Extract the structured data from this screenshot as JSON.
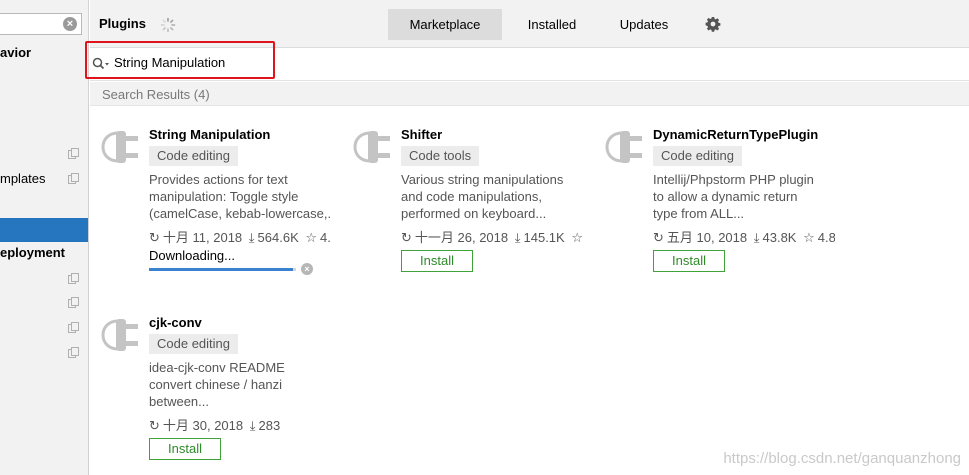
{
  "left_pane": {
    "search_value": "",
    "items": [
      "avior",
      "mplates",
      "eployment"
    ]
  },
  "header": {
    "title": "Plugins",
    "tabs": [
      "Marketplace",
      "Installed",
      "Updates"
    ],
    "active_tab": "Marketplace"
  },
  "search": {
    "value": "String Manipulation"
  },
  "results": {
    "label": "Search Results (4)"
  },
  "plugins": [
    {
      "name": "String Manipulation",
      "category": "Code editing",
      "description": [
        "Provides actions for text",
        "manipulation: Toggle style",
        "(camelCase, kebab-lowercase,."
      ],
      "date": "十月 11, 2018",
      "downloads": "564.6K",
      "rating": "4.",
      "status": "Downloading...",
      "progress": 0.98
    },
    {
      "name": "Shifter",
      "category": "Code tools",
      "description": [
        "Various string manipulations",
        "and code manipulations,",
        "performed on keyboard..."
      ],
      "date": "十一月 26, 2018",
      "downloads": "145.1K",
      "rating": "",
      "action": "Install"
    },
    {
      "name": "DynamicReturnTypePlugin",
      "category": "Code editing",
      "description": [
        "Intellij/Phpstorm PHP plugin",
        "to allow a dynamic return",
        "type from ALL..."
      ],
      "date": "五月 10, 2018",
      "downloads": "43.8K",
      "rating": "4.8",
      "action": "Install"
    },
    {
      "name": "cjk-conv",
      "category": "Code editing",
      "description": [
        "idea-cjk-conv README",
        "convert chinese / hanzi",
        "between..."
      ],
      "date": "十月 30, 2018",
      "downloads": "283",
      "action": "Install"
    }
  ],
  "watermark": "https://blog.csdn.net/ganquanzhong",
  "colors": {
    "accent": "#2675bf",
    "install_green": "#3fa33a",
    "highlight_red": "#e0151b"
  }
}
